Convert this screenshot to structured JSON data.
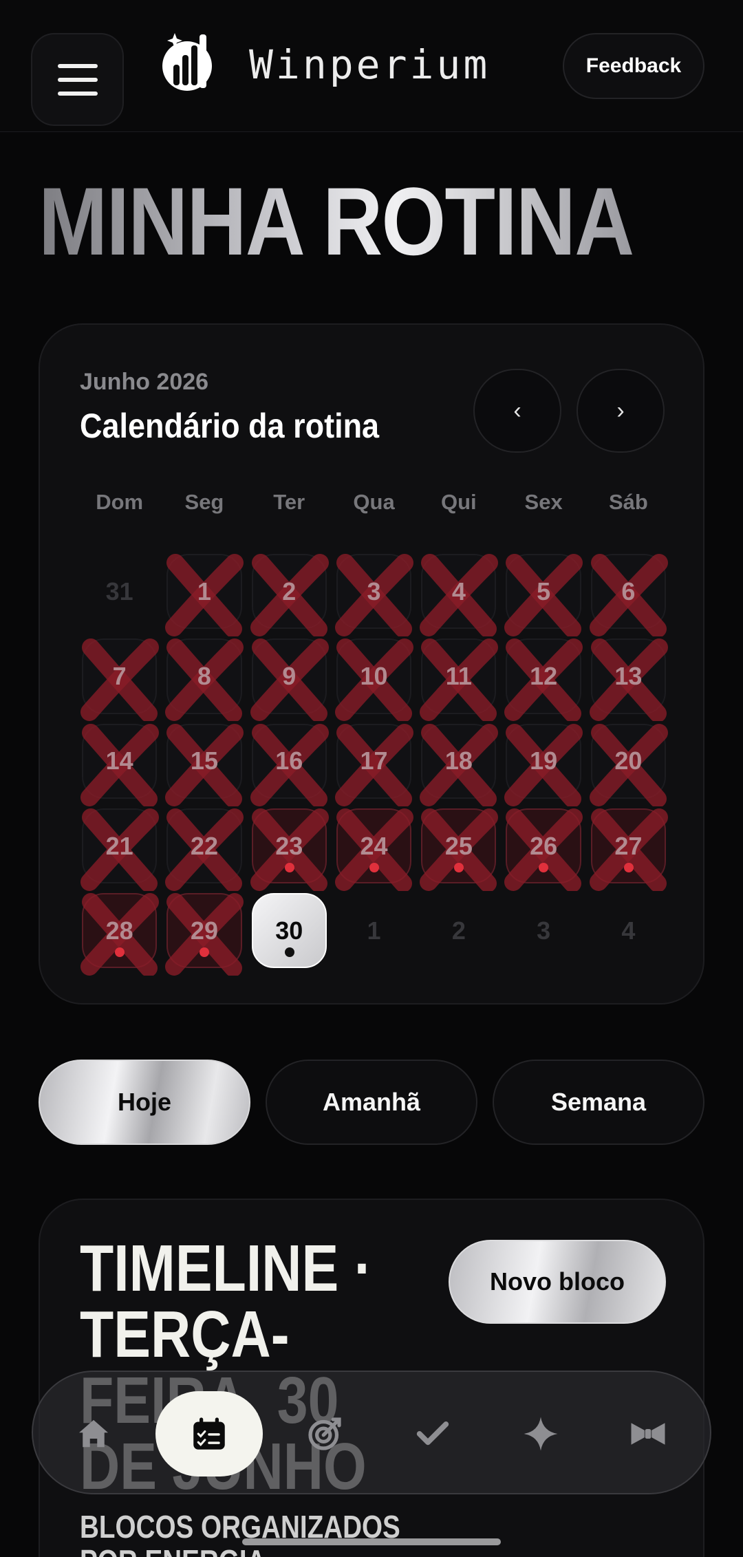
{
  "header": {
    "brand": "Winperium",
    "feedback_label": "Feedback"
  },
  "page": {
    "title": "MINHA ROTINA"
  },
  "calendar": {
    "month_label": "Junho 2026",
    "title": "Calendário da rotina",
    "prev_label": "‹",
    "next_label": "›",
    "weekdays": [
      "Dom",
      "Seg",
      "Ter",
      "Qua",
      "Qui",
      "Sex",
      "Sáb"
    ],
    "days": [
      {
        "n": "31",
        "outside": true
      },
      {
        "n": "1",
        "crossed": true
      },
      {
        "n": "2",
        "crossed": true
      },
      {
        "n": "3",
        "crossed": true
      },
      {
        "n": "4",
        "crossed": true
      },
      {
        "n": "5",
        "crossed": true
      },
      {
        "n": "6",
        "crossed": true
      },
      {
        "n": "7",
        "crossed": true
      },
      {
        "n": "8",
        "crossed": true
      },
      {
        "n": "9",
        "crossed": true
      },
      {
        "n": "10",
        "crossed": true
      },
      {
        "n": "11",
        "crossed": true
      },
      {
        "n": "12",
        "crossed": true
      },
      {
        "n": "13",
        "crossed": true
      },
      {
        "n": "14",
        "crossed": true
      },
      {
        "n": "15",
        "crossed": true
      },
      {
        "n": "16",
        "crossed": true
      },
      {
        "n": "17",
        "crossed": true
      },
      {
        "n": "18",
        "crossed": true
      },
      {
        "n": "19",
        "crossed": true
      },
      {
        "n": "20",
        "crossed": true
      },
      {
        "n": "21",
        "crossed": true
      },
      {
        "n": "22",
        "crossed": true
      },
      {
        "n": "23",
        "crossed": true,
        "marked": true,
        "dot": true
      },
      {
        "n": "24",
        "crossed": true,
        "marked": true,
        "dot": true
      },
      {
        "n": "25",
        "crossed": true,
        "marked": true,
        "dot": true
      },
      {
        "n": "26",
        "crossed": true,
        "marked": true,
        "dot": true
      },
      {
        "n": "27",
        "crossed": true,
        "marked": true,
        "dot": true
      },
      {
        "n": "28",
        "crossed": true,
        "marked": true,
        "dot": true
      },
      {
        "n": "29",
        "crossed": true,
        "marked": true,
        "dot": true
      },
      {
        "n": "30",
        "today": true,
        "dot": true
      },
      {
        "n": "1",
        "outside": true
      },
      {
        "n": "2",
        "outside": true
      },
      {
        "n": "3",
        "outside": true
      },
      {
        "n": "4",
        "outside": true
      }
    ]
  },
  "tabs": [
    {
      "label": "Hoje",
      "active": true
    },
    {
      "label": "Amanhã",
      "active": false
    },
    {
      "label": "Semana",
      "active": false
    }
  ],
  "timeline": {
    "title_lines": [
      "TIMELINE ·",
      "TERÇA-",
      "FEIRA, 30",
      "DE JUNHO"
    ],
    "subtitle_lines": [
      "BLOCOS ORGANIZADOS",
      "POR ENERGIA"
    ],
    "new_block_label": "Novo bloco"
  },
  "bottom_nav": [
    {
      "name": "home-icon",
      "active": false
    },
    {
      "name": "calendar-checklist-icon",
      "active": true
    },
    {
      "name": "target-icon",
      "active": false
    },
    {
      "name": "check-icon",
      "active": false
    },
    {
      "name": "sparkle-icon",
      "active": false
    },
    {
      "name": "bowtie-icon",
      "active": false
    }
  ],
  "colors": {
    "background": "#070708",
    "cross": "#8a1c28",
    "dot": "#e0303c",
    "active_nav": "#f4f4ee"
  }
}
